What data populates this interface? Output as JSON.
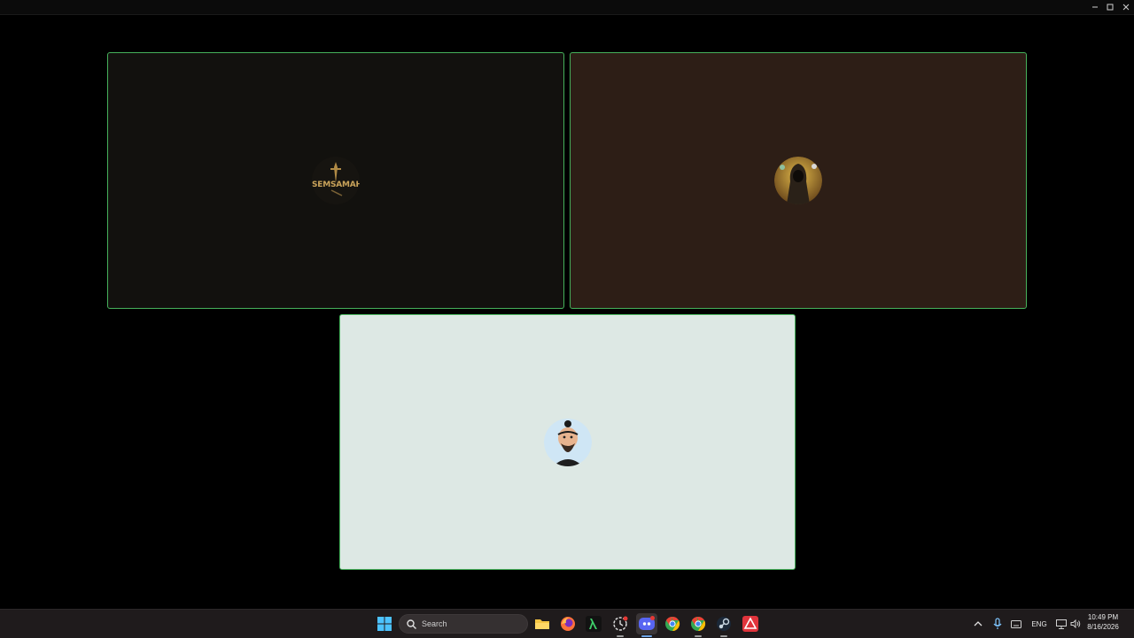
{
  "window": {
    "controls": [
      {
        "name": "minimize-button",
        "icon": "minimize-icon"
      },
      {
        "name": "maximize-button",
        "icon": "maximize-icon"
      },
      {
        "name": "close-button",
        "icon": "close-icon"
      }
    ]
  },
  "tiles": [
    {
      "name": "participant-tile-semsamah",
      "background": "#12110e",
      "border": "#46b15b",
      "avatar_icon": "semsamah-logo-avatar",
      "avatar_text": "SEMSAMAH"
    },
    {
      "name": "participant-tile-warrior",
      "background": "#2d1e16",
      "border": "#46b15b",
      "avatar_icon": "hooded-warrior-avatar"
    },
    {
      "name": "participant-tile-samurai",
      "background": "#dde8e4",
      "border": "#46b15b",
      "avatar_icon": "bearded-samurai-avatar"
    }
  ],
  "taskbar": {
    "search_placeholder": "Search",
    "apps": [
      {
        "name": "start-button",
        "icon": "windows-logo-icon"
      },
      {
        "name": "file-explorer-app",
        "icon": "folder-icon"
      },
      {
        "name": "firefox-app",
        "icon": "firefox-icon"
      },
      {
        "name": "terminal-app",
        "icon": "lambda-icon"
      },
      {
        "name": "snipping-app",
        "icon": "clock-app-icon"
      },
      {
        "name": "discord-app",
        "icon": "discord-icon",
        "badge": "active"
      },
      {
        "name": "chrome-app-1",
        "icon": "chrome-icon"
      },
      {
        "name": "chrome-app-2",
        "icon": "chrome-icon"
      },
      {
        "name": "steam-app",
        "icon": "steam-icon"
      },
      {
        "name": "red-app",
        "icon": "red-triangle-app-icon"
      }
    ],
    "tray": {
      "overflow_icon": "chevron-up-icon",
      "mic_icon": "microphone-icon",
      "keyboard_icon": "keyboard-icon",
      "language": "ENG",
      "network_icon": "network-icon",
      "volume_icon": "speaker-icon"
    },
    "clock": {
      "time": "10:49 PM",
      "date": "8/16/2026"
    }
  },
  "colors": {
    "accent": "#46b15b",
    "taskbar": "#1f1b1c",
    "stage": "#000000"
  }
}
